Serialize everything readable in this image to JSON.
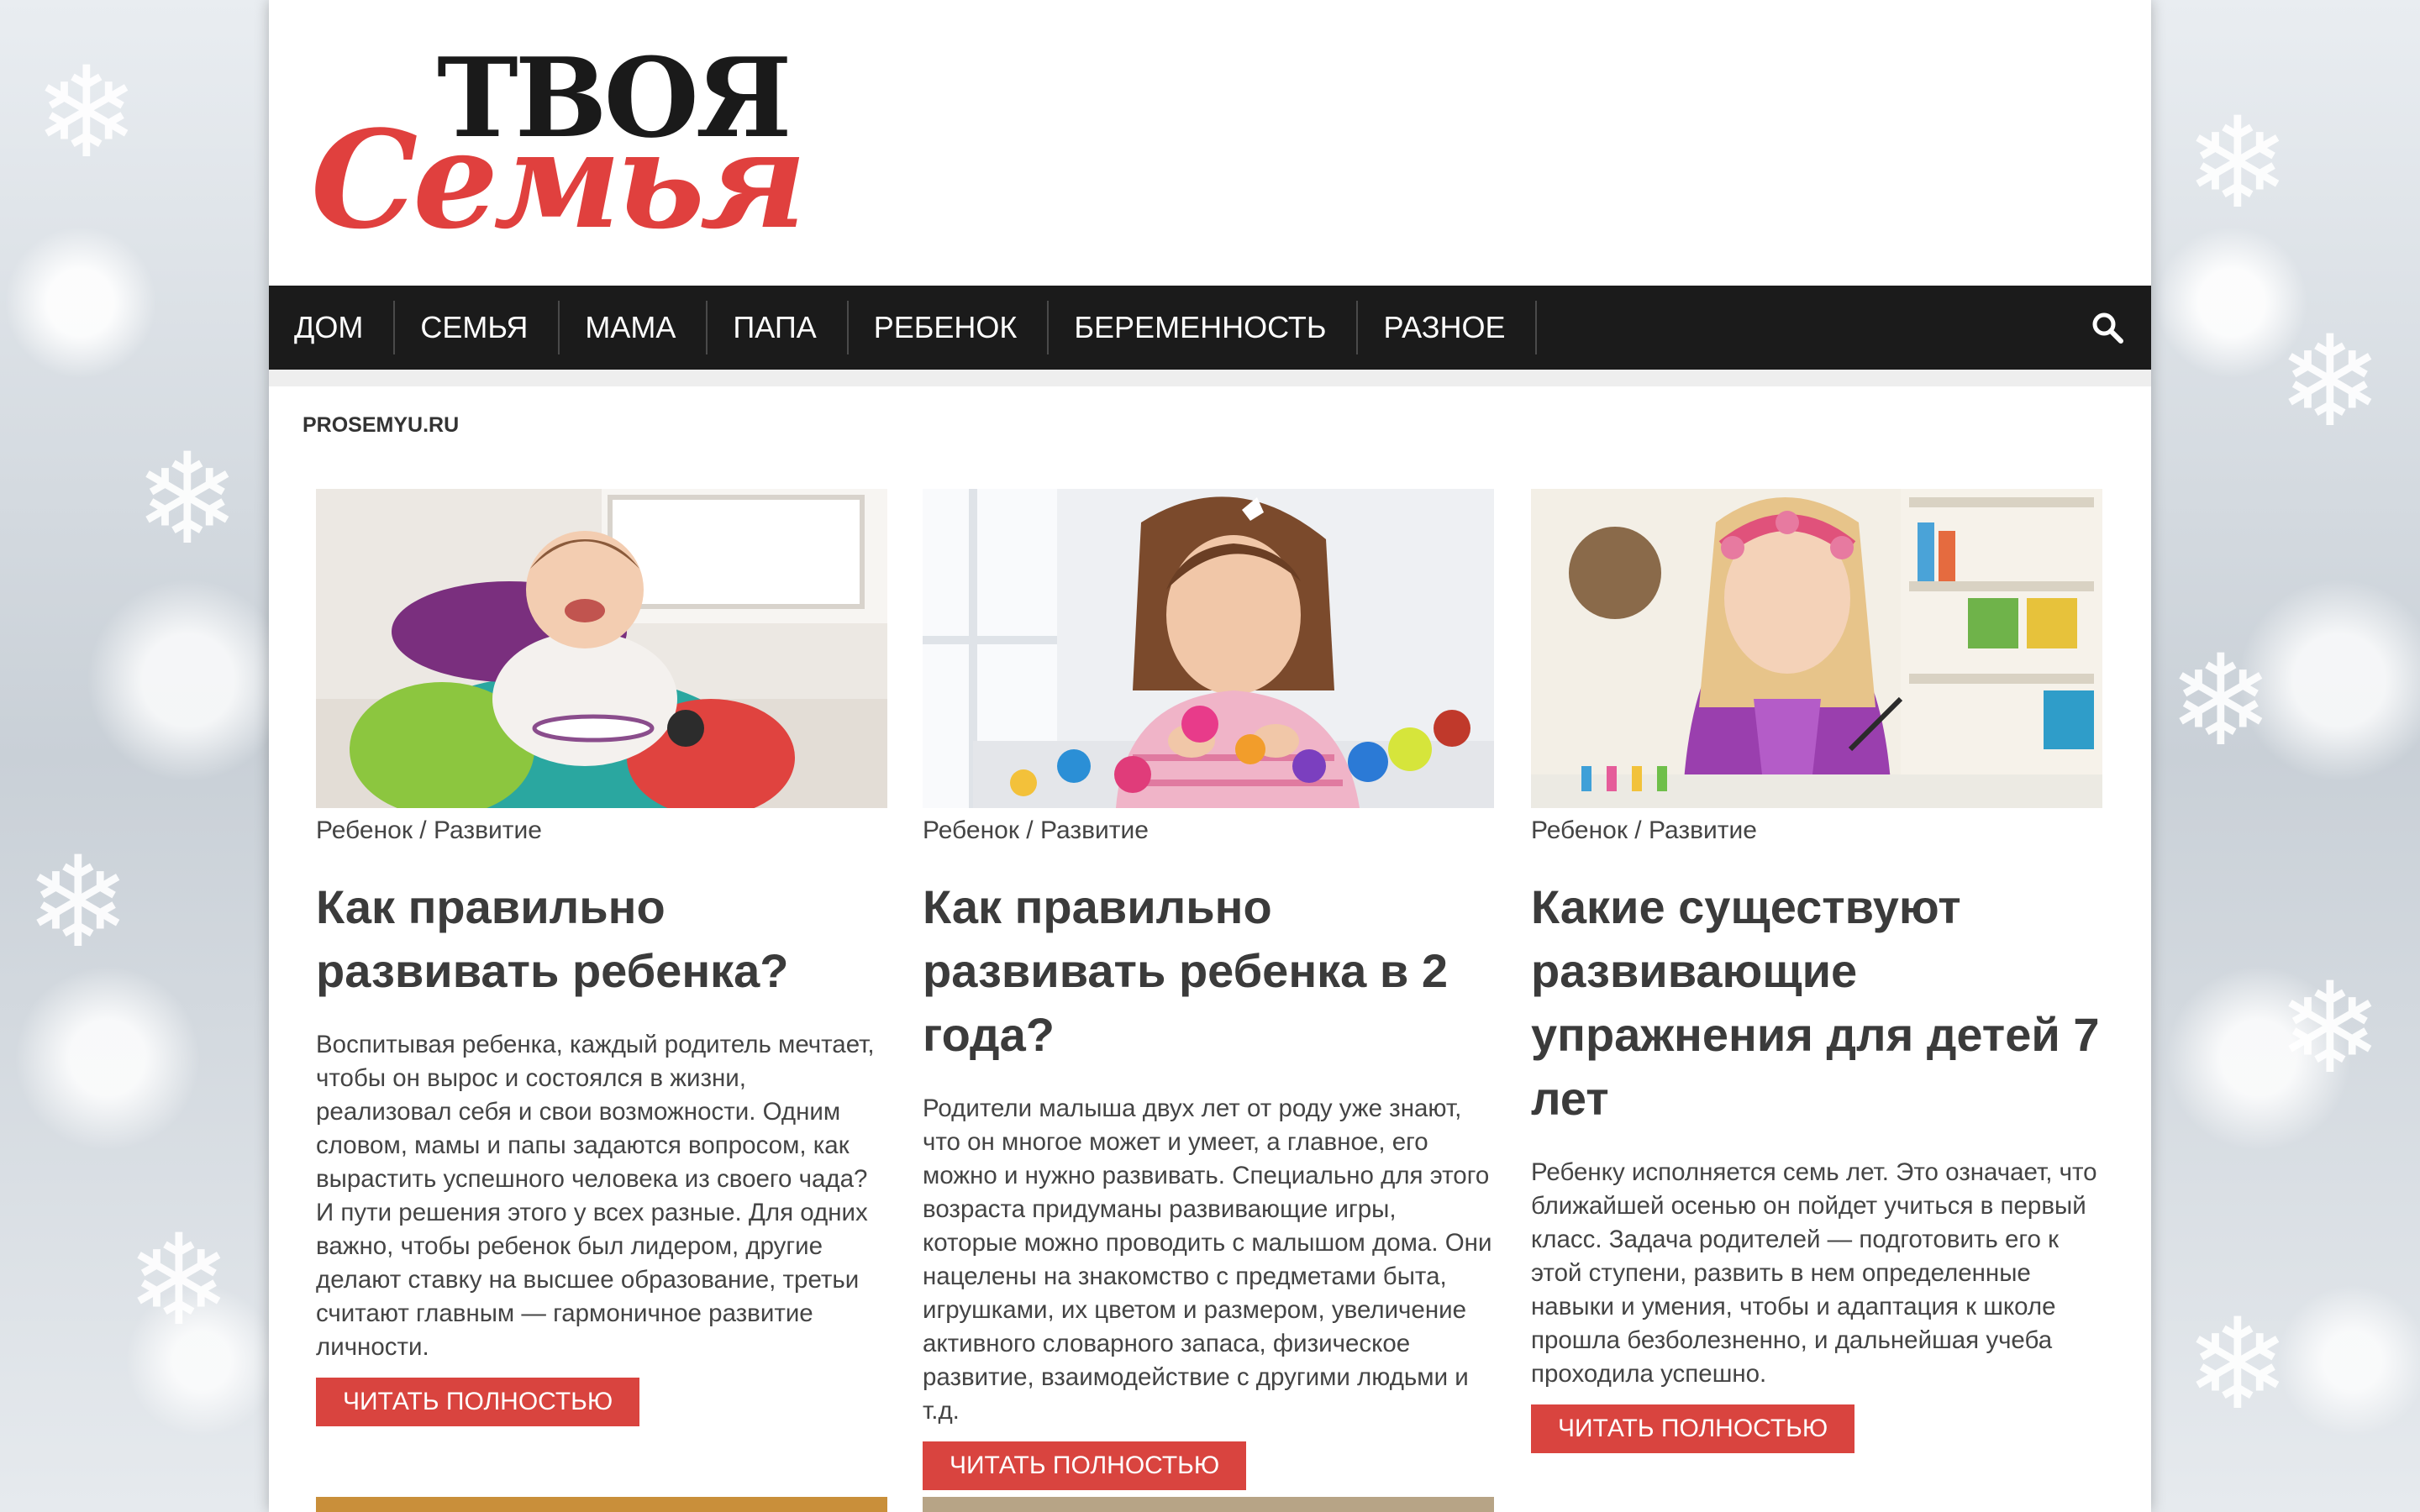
{
  "logo": {
    "top": "ТВОЯ",
    "bottom": "Семья"
  },
  "nav": {
    "items": [
      "ДОМ",
      "СЕМЬЯ",
      "МАМА",
      "ПАПА",
      "РЕБЕНОК",
      "БЕРЕМЕННОСТЬ",
      "РАЗНОЕ"
    ],
    "search_icon": "search-icon"
  },
  "site_label": "PROSEMYU.RU",
  "articles": [
    {
      "category": "Ребенок / Развитие",
      "title": "Как правильно развивать ребенка?",
      "excerpt": "Воспитывая ребенка, каждый родитель мечтает, чтобы он вырос и состоялся в жизни, реализовал себя и свои возможности. Одним словом, мамы и папы задаются вопросом, как вырастить успешного человека из своего чада? И пути решения этого у всех разные. Для одних важно, чтобы ребенок был лидером, другие делают ставку на высшее образование, третьи считают главным — гармоничное развитие личности.",
      "button": "ЧИТАТЬ ПОЛНОСТЬЮ"
    },
    {
      "category": "Ребенок / Развитие",
      "title": "Как правильно развивать ребенка в 2 года?",
      "excerpt": "Родители малыша двух лет от роду уже знают, что он многое может и умеет, а главное, его можно и нужно развивать. Специально для этого возраста придуманы развивающие игры, которые можно проводить с малышом дома. Они нацелены на знакомство с предметами быта, игрушками, их цветом и размером, увеличение активного словарного запаса, физическое развитие, взаимодействие с другими людьми и т.д.",
      "button": "ЧИТАТЬ ПОЛНОСТЬЮ"
    },
    {
      "category": "Ребенок / Развитие",
      "title": "Какие существуют развивающие упражнения для детей 7 лет",
      "excerpt": "Ребенку исполняется семь лет. Это означает, что ближайшей осенью он пойдет учиться в первый класс. Задача родителей — подготовить его к этой ступени, развить в нем определенные навыки и умения, чтобы и адаптация к школе прошла безболезненно, и дальнейшая учеба проходила успешно.",
      "button": "ЧИТАТЬ ПОЛНОСТЬЮ"
    }
  ],
  "colors": {
    "accent": "#d9443f",
    "nav_bg": "#1b1b1b",
    "logo_red": "#e0403e"
  }
}
